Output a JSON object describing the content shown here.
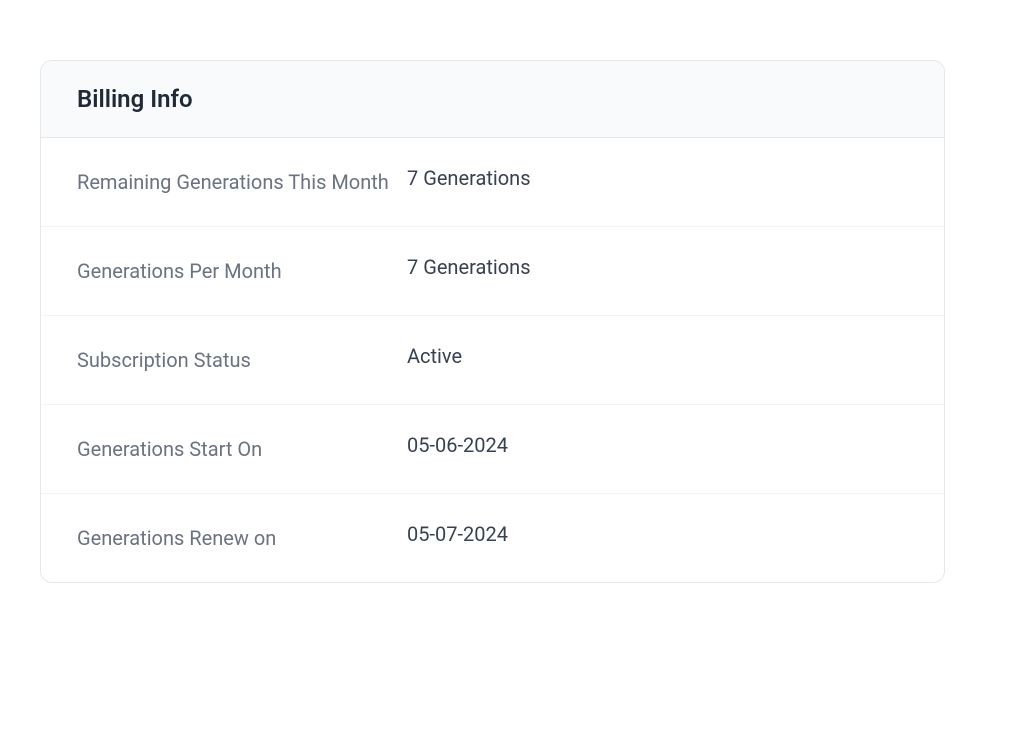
{
  "card": {
    "title": "Billing Info",
    "rows": [
      {
        "label": "Remaining Generations This Month",
        "value": "7 Generations"
      },
      {
        "label": "Generations Per Month",
        "value": "7 Generations"
      },
      {
        "label": "Subscription Status",
        "value": "Active"
      },
      {
        "label": "Generations Start On",
        "value": "05-06-2024"
      },
      {
        "label": "Generations Renew on",
        "value": "05-07-2024"
      }
    ]
  }
}
